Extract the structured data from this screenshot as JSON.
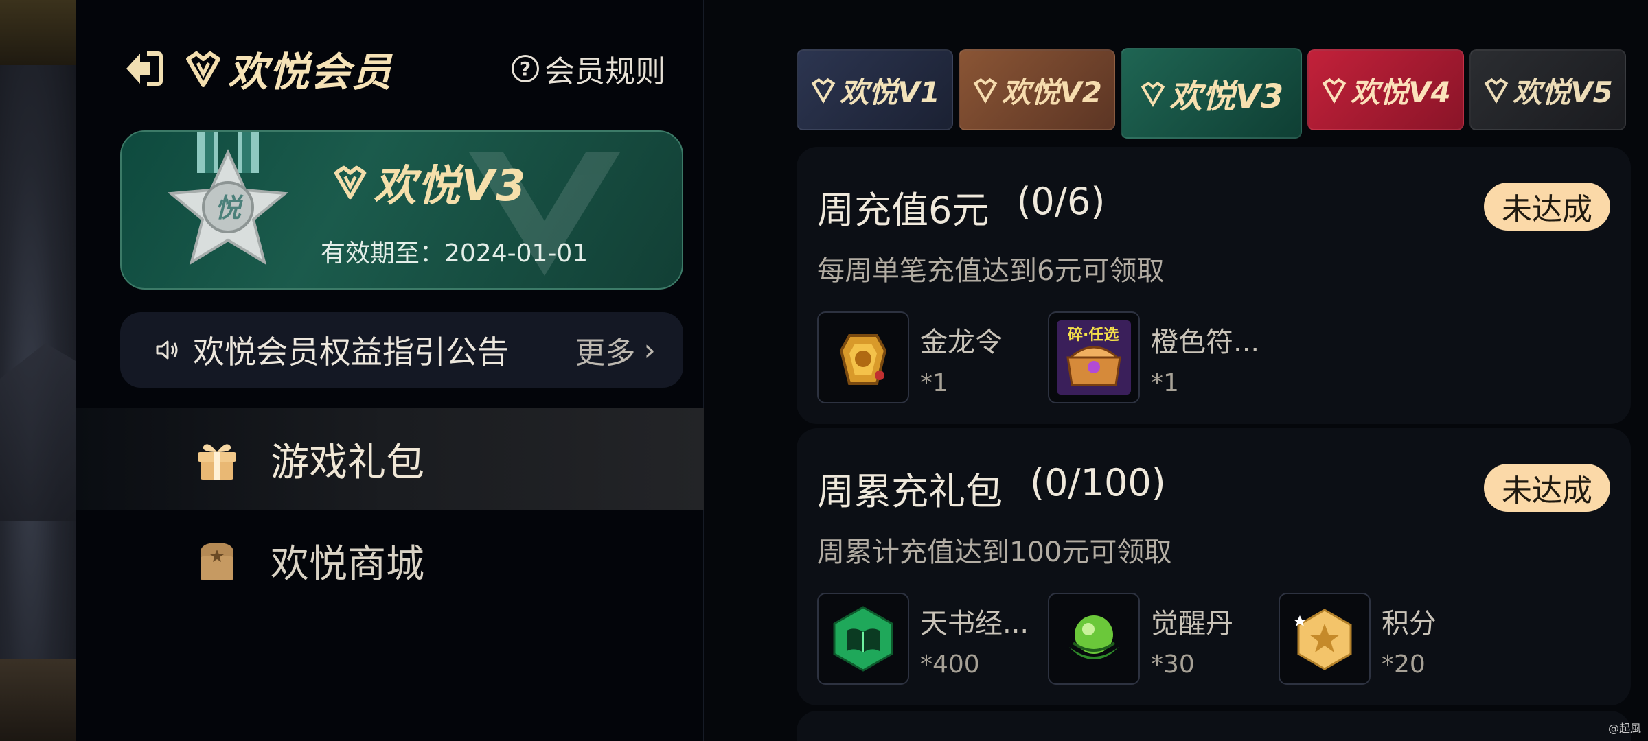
{
  "header": {
    "title": "欢悦会员",
    "rules_label": "会员规则"
  },
  "member_card": {
    "level": "欢悦V3",
    "medal_char": "悦",
    "expiry": "有效期至：2024-01-01"
  },
  "notice": {
    "text": "欢悦会员权益指引公告",
    "more": "更多"
  },
  "menu": [
    {
      "label": "游戏礼包",
      "active": true
    },
    {
      "label": "欢悦商城",
      "active": false
    }
  ],
  "tabs": [
    "欢悦V1",
    "欢悦V2",
    "欢悦V3",
    "欢悦V4",
    "欢悦V5"
  ],
  "selected_tab": "欢悦V3",
  "tasks": [
    {
      "title": "周充值6元",
      "progress": "(0/6)",
      "desc": "每周单笔充值达到6元可领取",
      "status": "未达成",
      "rewards": [
        {
          "name": "金龙令",
          "qty": "*1",
          "icon": "gold-dragon-token-icon"
        },
        {
          "name": "橙色符...",
          "qty": "*1",
          "icon": "orange-rune-chest-icon",
          "badge": "碎·任选"
        }
      ]
    },
    {
      "title": "周累充礼包",
      "progress": "(0/100)",
      "desc": "周累计充值达到100元可领取",
      "status": "未达成",
      "rewards": [
        {
          "name": "天书经...",
          "qty": "*400",
          "icon": "green-book-icon"
        },
        {
          "name": "觉醒丹",
          "qty": "*30",
          "icon": "green-pill-icon"
        },
        {
          "name": "积分",
          "qty": "*20",
          "icon": "star-points-icon"
        }
      ]
    }
  ],
  "watermark": "@起風",
  "colors": {
    "accent_gold": "#f5e2b6",
    "status_bg": "#fbd9a8",
    "v3_green": "#1b5b4c",
    "v4_red": "#c2213a"
  }
}
